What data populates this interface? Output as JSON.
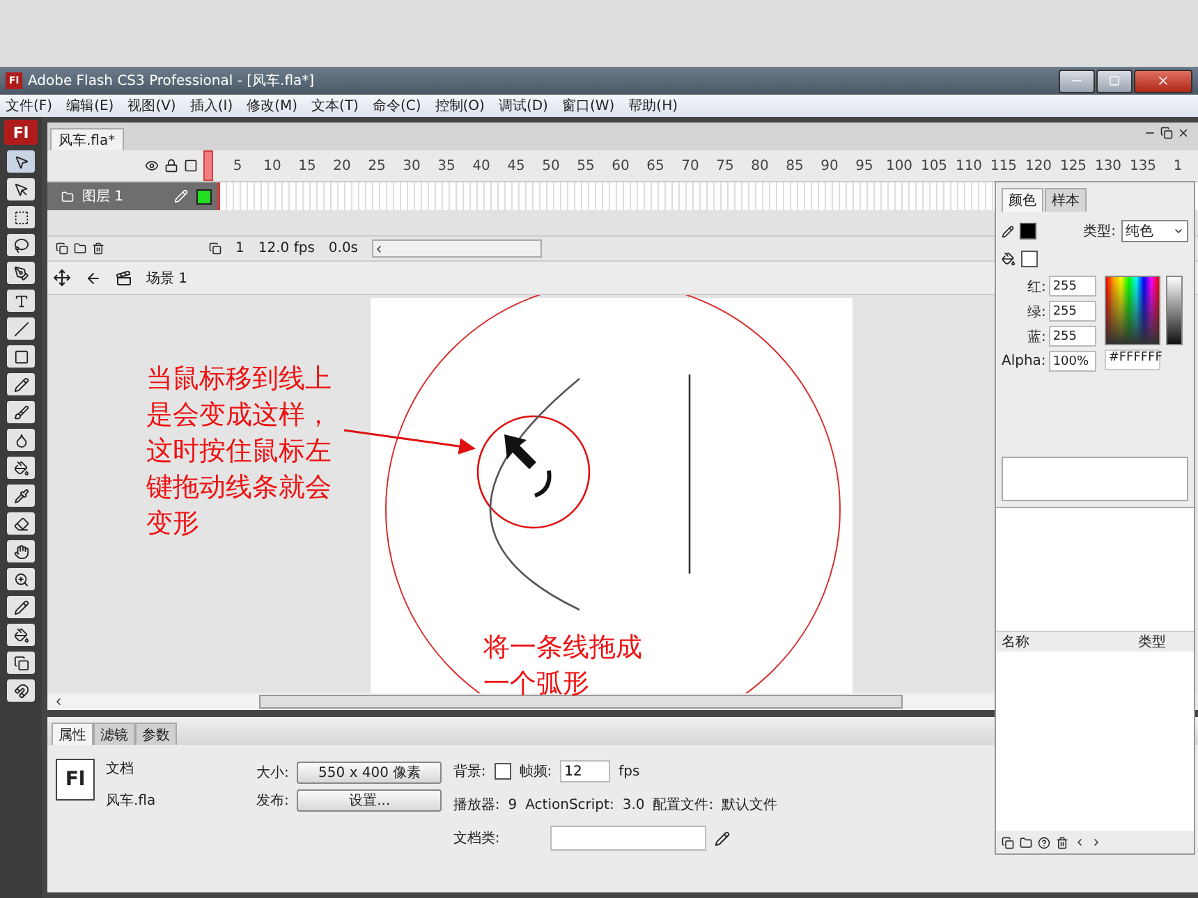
{
  "window": {
    "title": "Adobe Flash CS3 Professional - [风车.fla*]",
    "logo": "Fl"
  },
  "menu": [
    "文件(F)",
    "编辑(E)",
    "视图(V)",
    "插入(I)",
    "修改(M)",
    "文本(T)",
    "命令(C)",
    "控制(O)",
    "调试(D)",
    "窗口(W)",
    "帮助(H)"
  ],
  "toolbar": {
    "logo": "Fl"
  },
  "document_tabs": [
    {
      "label": "风车.fla*",
      "selected": true
    }
  ],
  "timeline": {
    "frame_numbers": [
      "5",
      "10",
      "15",
      "20",
      "25",
      "30",
      "35",
      "40",
      "45",
      "50",
      "55",
      "60",
      "65",
      "70",
      "75",
      "80",
      "85",
      "90",
      "95",
      "100",
      "105",
      "110",
      "115",
      "120",
      "125",
      "130",
      "135",
      "1"
    ],
    "layers": [
      {
        "name": "图层 1",
        "selected": true,
        "color": "#22dd22"
      }
    ],
    "current_frame": "1",
    "frame_rate": "12.0 fps",
    "elapsed": "0.0s"
  },
  "edit_bar": {
    "scene": "场景 1"
  },
  "annotations": [
    {
      "text": "当鼠标移到线上是会变成这样，这时按住鼠标左键拖动线条就会变形"
    },
    {
      "text": "将一条线拖成一个弧形"
    }
  ],
  "color_panel": {
    "tabs": [
      {
        "label": "颜色",
        "selected": true
      },
      {
        "label": "样本",
        "selected": false
      }
    ],
    "type_label": "类型:",
    "type_value": "纯色",
    "channels": [
      {
        "label": "红:",
        "value": "255"
      },
      {
        "label": "绿:",
        "value": "255"
      },
      {
        "label": "蓝:",
        "value": "255"
      },
      {
        "label": "Alpha:",
        "value": "100%"
      }
    ],
    "hex": "#FFFFFF"
  },
  "library_panel": {
    "columns": [
      "名称",
      "类型"
    ]
  },
  "properties": {
    "tabs": [
      {
        "label": "属性",
        "selected": true
      },
      {
        "label": "滤镜",
        "selected": false
      },
      {
        "label": "参数",
        "selected": false
      }
    ],
    "doc_icon": "Fl",
    "doc_type": "文档",
    "file_name": "风车.fla",
    "size_label": "大小:",
    "size_button": "550 x 400 像素",
    "publish_label": "发布:",
    "settings_button": "设置...",
    "background_label": "背景:",
    "frame_rate_label": "帧频:",
    "frame_rate": "12",
    "frame_rate_unit": "fps",
    "player_label": "播放器:",
    "player": "9",
    "as_label": "ActionScript:",
    "as_version": "3.0",
    "profile_label": "配置文件:",
    "profile": "默认文件",
    "doc_class_label": "文档类:"
  }
}
